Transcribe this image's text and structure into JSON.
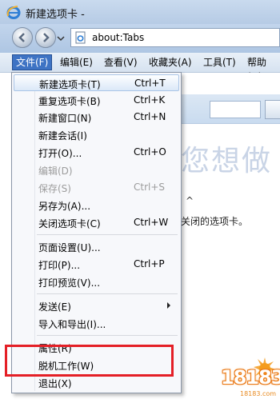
{
  "window": {
    "title": "新建选项卡 -"
  },
  "address": {
    "url": "about:Tabs"
  },
  "menubar": [
    {
      "label": "文件(F)"
    },
    {
      "label": "编辑(E)"
    },
    {
      "label": "查看(V)"
    },
    {
      "label": "收藏夹(A)"
    },
    {
      "label": "工具(T)"
    },
    {
      "label": "帮助(H)"
    }
  ],
  "file_menu": [
    {
      "label": "新建选项卡(T)",
      "shortcut": "Ctrl+T"
    },
    {
      "label": "重复选项卡(B)",
      "shortcut": "Ctrl+K"
    },
    {
      "label": "新建窗口(N)",
      "shortcut": "Ctrl+N"
    },
    {
      "label": "新建会话(I)",
      "shortcut": ""
    },
    {
      "label": "打开(O)...",
      "shortcut": "Ctrl+O"
    },
    {
      "label": "编辑(D)",
      "shortcut": ""
    },
    {
      "label": "保存(S)",
      "shortcut": "Ctrl+S"
    },
    {
      "label": "另存为(A)...",
      "shortcut": ""
    },
    {
      "label": "关闭选项卡(C)",
      "shortcut": "Ctrl+W"
    },
    {
      "label": "页面设置(U)...",
      "shortcut": ""
    },
    {
      "label": "打印(P)...",
      "shortcut": "Ctrl+P"
    },
    {
      "label": "打印预览(V)...",
      "shortcut": ""
    },
    {
      "label": "发送(E)",
      "shortcut": ""
    },
    {
      "label": "导入和导出(I)...",
      "shortcut": ""
    },
    {
      "label": "属性(R)",
      "shortcut": ""
    },
    {
      "label": "脱机工作(W)",
      "shortcut": ""
    },
    {
      "label": "退出(X)",
      "shortcut": ""
    }
  ],
  "page": {
    "heading": "您想做",
    "caret": "^",
    "text": "关闭的选项卡。"
  },
  "watermark": {
    "logo": "18183",
    "sub": "18183.com"
  },
  "colors": {
    "highlight_box": "#e41f26",
    "menu_active": "#3e73c4"
  }
}
